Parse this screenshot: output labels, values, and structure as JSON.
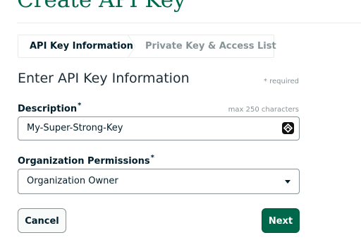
{
  "page": {
    "title": "Create API Key"
  },
  "wizard": {
    "steps": [
      {
        "label": "API Key Information",
        "active": true
      },
      {
        "label": "Private Key & Access List",
        "active": false
      }
    ]
  },
  "form": {
    "heading": "Enter API Key Information",
    "required_note": "* required",
    "description": {
      "label": "Description",
      "required_mark": "*",
      "hint": "max 250 characters",
      "value": "My-Super-Strong-Key",
      "icon": "password-manager-icon"
    },
    "org_permissions": {
      "label": "Organization Permissions",
      "required_mark": "*",
      "selected": "Organization Owner",
      "icon": "caret-down-icon"
    }
  },
  "actions": {
    "cancel_label": "Cancel",
    "next_label": "Next"
  },
  "colors": {
    "brand": "#00684a",
    "text": "#001e2b",
    "muted": "#889397",
    "border": "#e8edeb"
  }
}
